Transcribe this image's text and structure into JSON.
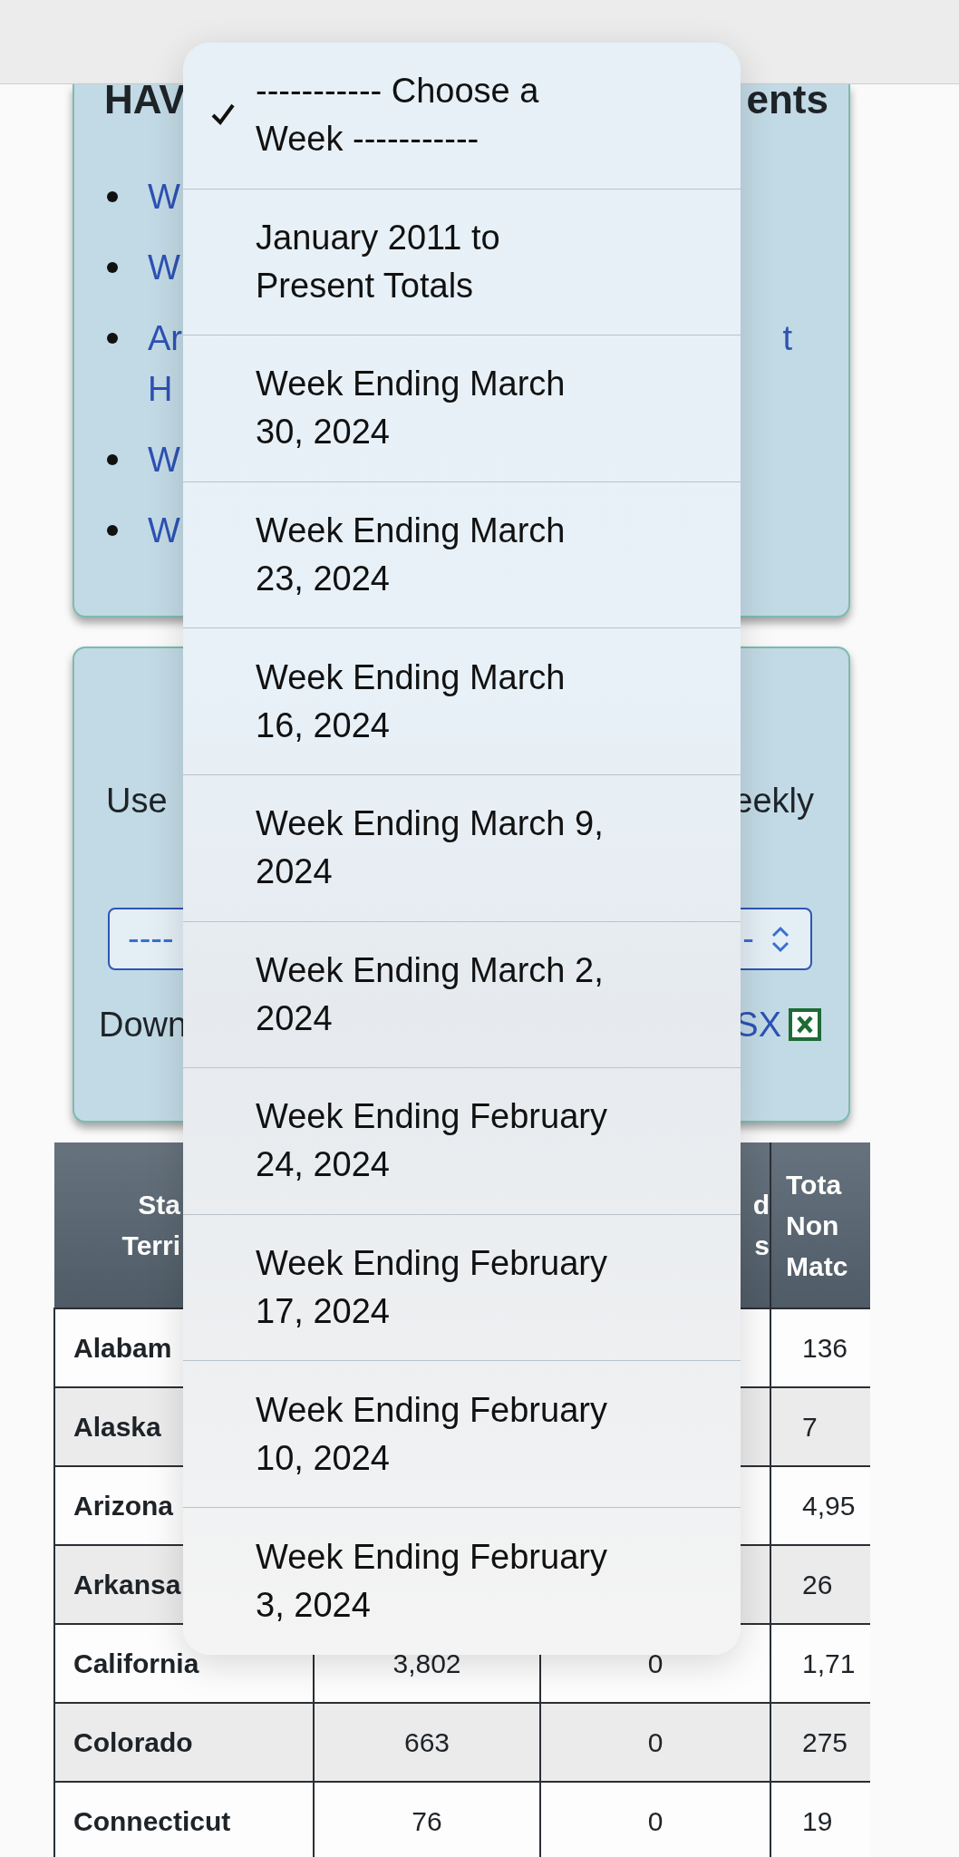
{
  "info_card": {
    "heading_left": "HAV",
    "heading_right": "ents",
    "links": [
      {
        "text": "W"
      },
      {
        "text": "W"
      },
      {
        "text": "Ar",
        "text_right": "t",
        "second_line": "H"
      },
      {
        "text": "W"
      },
      {
        "text": "W"
      }
    ]
  },
  "select_card": {
    "text_left": "Use",
    "text_right": "eekly",
    "select": {
      "value_left": "----",
      "value_right": "-"
    },
    "download_left": "Down",
    "download_link": "SX"
  },
  "table": {
    "headers": {
      "column_1": [
        "Sta",
        "Terri"
      ],
      "column_3": [
        "d",
        "s"
      ],
      "column_4": [
        "Tota",
        "Non",
        "Matc"
      ]
    },
    "rows": [
      {
        "state": "Alabam",
        "column_4": "136"
      },
      {
        "state": "Alaska",
        "column_4": "7"
      },
      {
        "state": "Arizona",
        "column_4": "4,95"
      },
      {
        "state": "Arkansa",
        "column_4": "26"
      },
      {
        "state": "California",
        "column_2": "3,802",
        "column_3": "0",
        "column_4": "1,71"
      },
      {
        "state": "Colorado",
        "column_2": "663",
        "column_3": "0",
        "column_4": "275"
      },
      {
        "state": "Connecticut",
        "column_2": "76",
        "column_3": "0",
        "column_4": "19"
      }
    ]
  },
  "dropdown": {
    "options": [
      {
        "label": "----------- Choose a Week -----------",
        "selected": true
      },
      {
        "label": "January 2011 to Present Totals",
        "selected": false
      },
      {
        "label": "Week Ending March 30, 2024",
        "selected": false
      },
      {
        "label": "Week Ending March 23, 2024",
        "selected": false
      },
      {
        "label": "Week Ending March 16, 2024",
        "selected": false
      },
      {
        "label": "Week Ending March 9, 2024",
        "selected": false
      },
      {
        "label": "Week Ending March 2, 2024",
        "selected": false
      },
      {
        "label": "Week Ending February 24, 2024",
        "selected": false
      },
      {
        "label": "Week Ending February 17, 2024",
        "selected": false
      },
      {
        "label": "Week Ending February 10, 2024",
        "selected": false
      },
      {
        "label": "Week Ending February 3, 2024",
        "selected": false
      }
    ]
  }
}
